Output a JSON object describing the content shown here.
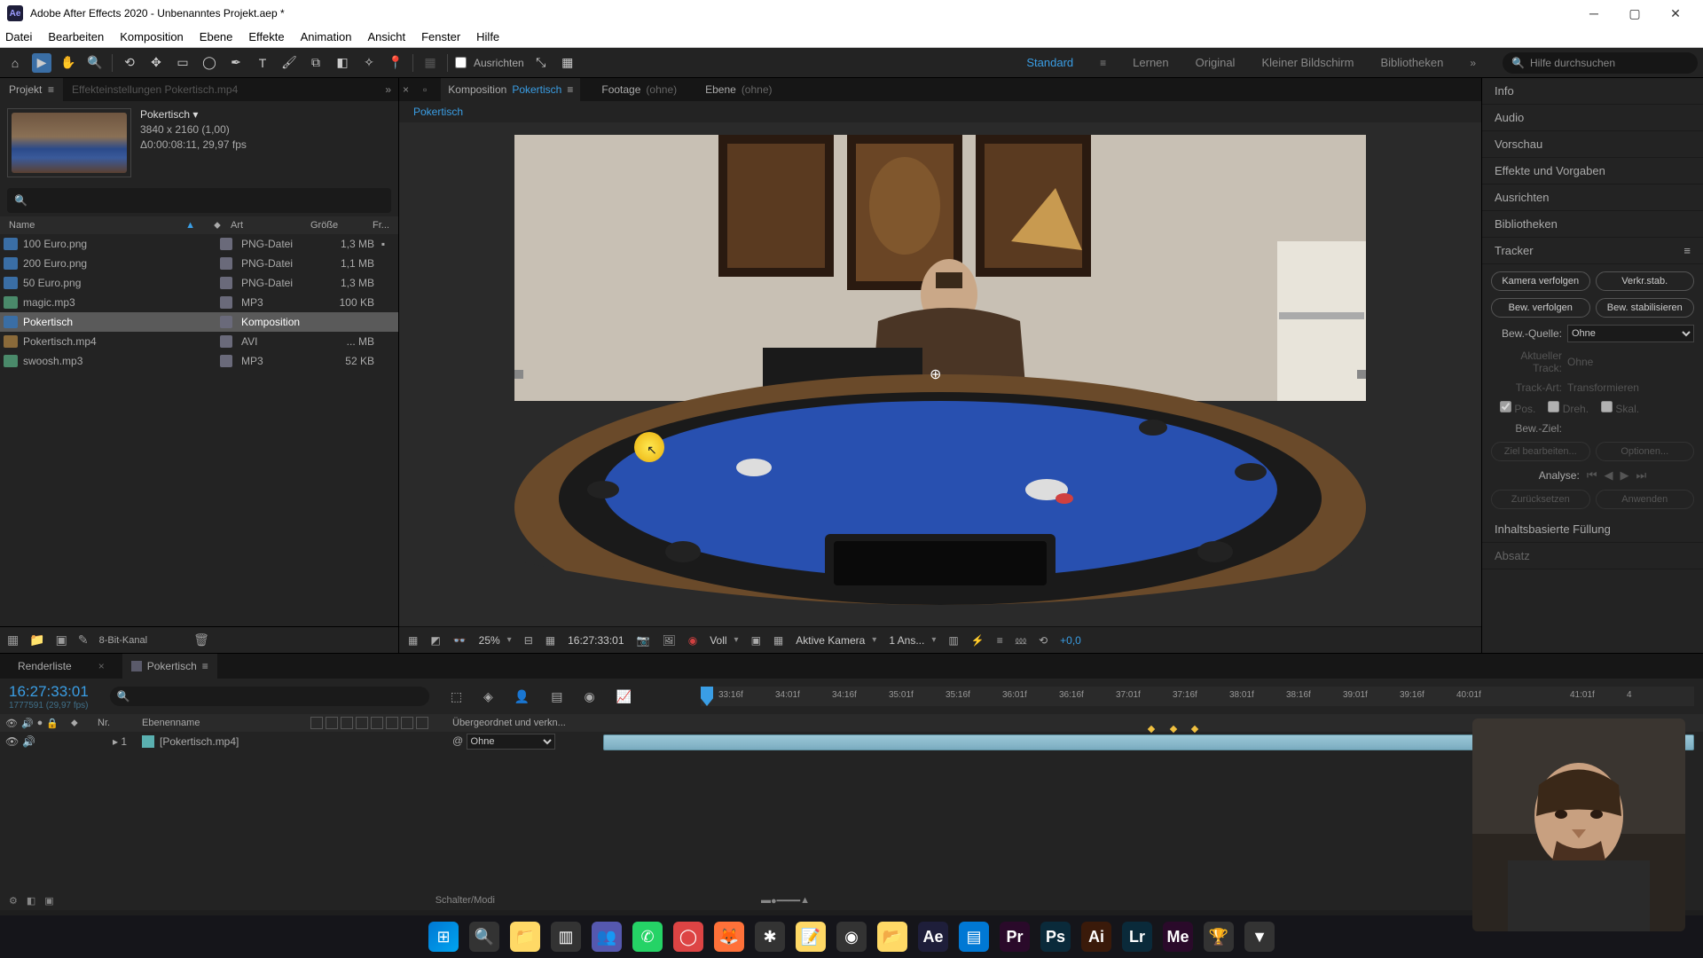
{
  "titlebar": {
    "logo": "Ae",
    "title": "Adobe After Effects 2020 - Unbenanntes Projekt.aep *"
  },
  "menu": [
    "Datei",
    "Bearbeiten",
    "Komposition",
    "Ebene",
    "Effekte",
    "Animation",
    "Ansicht",
    "Fenster",
    "Hilfe"
  ],
  "toolbar": {
    "align": "Ausrichten",
    "workspaces": [
      "Standard",
      "Lernen",
      "Original",
      "Kleiner Bildschirm",
      "Bibliotheken"
    ],
    "search_ph": "Hilfe durchsuchen"
  },
  "project": {
    "tab": "Projekt",
    "tab2": "Effekteinstellungen Pokertisch.mp4",
    "comp_name": "Pokertisch ▾",
    "comp_res": "3840 x 2160 (1,00)",
    "comp_dur": "Δ0:00:08:11, 29,97 fps",
    "cols": {
      "name": "Name",
      "art": "Art",
      "size": "Größe",
      "fr": "Fr..."
    },
    "items": [
      {
        "name": "100 Euro.png",
        "type": "PNG-Datei",
        "size": "1,3 MB",
        "ico": "img",
        "fr": "▪"
      },
      {
        "name": "200 Euro.png",
        "type": "PNG-Datei",
        "size": "1,1 MB",
        "ico": "img",
        "fr": ""
      },
      {
        "name": "50 Euro.png",
        "type": "PNG-Datei",
        "size": "1,3 MB",
        "ico": "img",
        "fr": ""
      },
      {
        "name": "magic.mp3",
        "type": "MP3",
        "size": "100 KB",
        "ico": "au",
        "fr": ""
      },
      {
        "name": "Pokertisch",
        "type": "Komposition",
        "size": "",
        "ico": "cmp",
        "fr": "",
        "sel": true
      },
      {
        "name": "Pokertisch.mp4",
        "type": "AVI",
        "size": "... MB",
        "ico": "av",
        "fr": ""
      },
      {
        "name": "swoosh.mp3",
        "type": "MP3",
        "size": "52 KB",
        "ico": "au",
        "fr": ""
      }
    ],
    "footer_mode": "8-Bit-Kanal"
  },
  "comp": {
    "tab_prefix": "Komposition",
    "tab_name": "Pokertisch",
    "footage": "Footage",
    "footage_v": "(ohne)",
    "ebene": "Ebene",
    "ebene_v": "(ohne)",
    "breadcrumb": "Pokertisch",
    "footer": {
      "zoom": "25%",
      "tc": "16:27:33:01",
      "res": "Voll",
      "camera": "Aktive Kamera",
      "views": "1 Ans...",
      "exp": "+0,0"
    }
  },
  "rpanels": {
    "info": "Info",
    "audio": "Audio",
    "vorschau": "Vorschau",
    "effekte": "Effekte und Vorgaben",
    "ausrichten": "Ausrichten",
    "bibliotheken": "Bibliotheken",
    "tracker": "Tracker",
    "tracker_panel": {
      "btn1": "Kamera verfolgen",
      "btn2": "Verkr.stab.",
      "btn3": "Bew. verfolgen",
      "btn4": "Bew. stabilisieren",
      "src": "Bew.-Quelle:",
      "src_v": "Ohne",
      "track": "Aktueller Track:",
      "track_v": "Ohne",
      "art": "Track-Art:",
      "art_v": "Transformieren",
      "pos": "Pos.",
      "dreh": "Dreh.",
      "skal": "Skal.",
      "ziel": "Bew.-Ziel:",
      "edit": "Ziel bearbeiten...",
      "opt": "Optionen...",
      "analyse": "Analyse:",
      "reset": "Zurücksetzen",
      "apply": "Anwenden"
    },
    "fill": "Inhaltsbasierte Füllung",
    "absatz": "Absatz"
  },
  "timeline": {
    "tab_render": "Renderliste",
    "tab_comp": "Pokertisch",
    "tc": "16:27:33:01",
    "tc_sub": "1777591 (29,97 fps)",
    "cols": {
      "nr": "Nr.",
      "layer": "Ebenenname",
      "parent": "Übergeordnet und verkn..."
    },
    "layer": {
      "nr": "1",
      "name": "[Pokertisch.mp4]",
      "parent": "Ohne"
    },
    "ticks": [
      "33:16f",
      "34:01f",
      "34:16f",
      "35:01f",
      "35:16f",
      "36:01f",
      "36:16f",
      "37:01f",
      "37:16f",
      "38:01f",
      "38:16f",
      "39:01f",
      "39:16f",
      "40:01f",
      "",
      "41:01f",
      "4"
    ],
    "footer": "Schalter/Modi"
  },
  "taskbar": {
    "ae": "Ae",
    "pr": "Pr",
    "ps": "Ps",
    "ai": "Ai",
    "lr": "Lr",
    "me": "Me"
  }
}
